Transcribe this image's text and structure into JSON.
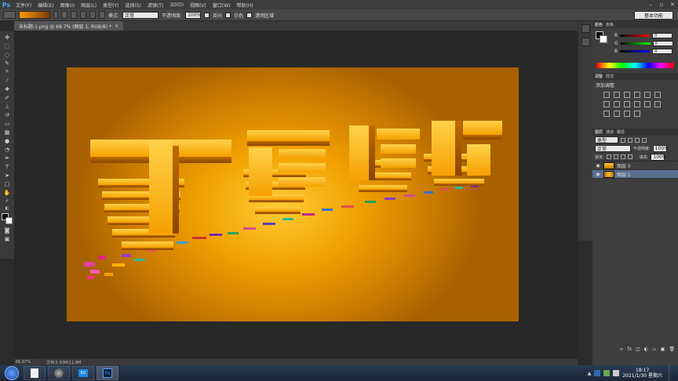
{
  "app": {
    "logo": "Ps"
  },
  "menubar": {
    "items": [
      "文件(F)",
      "编辑(E)",
      "图像(I)",
      "图层(L)",
      "类型(Y)",
      "选择(S)",
      "滤镜(T)",
      "3D(D)",
      "视图(V)",
      "窗口(W)",
      "帮助(H)"
    ]
  },
  "options": {
    "mode_label": "模式:",
    "mode_value": "正常",
    "opacity_label": "不透明度:",
    "opacity_value": "100%",
    "reverse_label": "反向",
    "dither_label": "仿色",
    "transparency_label": "透明区域",
    "workspace": "基本功能"
  },
  "document": {
    "tab_title": "未标题-1.png @ 66.7% (图层 1, RGB/8) *",
    "zoom": "66.67%",
    "doc_info": "文档:5.93M/11.8M"
  },
  "color_panel": {
    "tabs": [
      "颜色",
      "色板"
    ],
    "channels": [
      {
        "label": "R",
        "value": "0"
      },
      {
        "label": "G",
        "value": "0"
      },
      {
        "label": "B",
        "value": "0"
      }
    ]
  },
  "adjustments_panel": {
    "tabs": [
      "调整",
      "样式"
    ],
    "title": "添加调整"
  },
  "layers_panel": {
    "tabs": [
      "图层",
      "通道",
      "路径"
    ],
    "filter_label": "类型",
    "blend_mode": "正常",
    "opacity_label": "不透明度:",
    "opacity_value": "100%",
    "lock_label": "锁定:",
    "fill_label": "填充:",
    "fill_value": "100%",
    "layers": [
      {
        "name": "图层 0",
        "selected": false
      },
      {
        "name": "图层 1",
        "selected": true
      }
    ]
  },
  "taskbar": {
    "time": "18:17",
    "date": "2021/1/30 星期六"
  },
  "colors": {
    "accent_ps": "#4aa3ff",
    "canvas_center": "#ffcc33",
    "canvas_edge": "#a86100",
    "layer_selected": "#5a6e8e"
  }
}
